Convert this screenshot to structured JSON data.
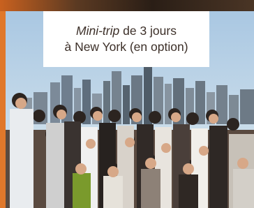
{
  "caption": {
    "line1_italic": "Mini-trip",
    "line1_rest": " de 3 jours",
    "line2": "à New York (en option)"
  },
  "photo": {
    "subject": "group-of-students-with-new-york-skyline",
    "colors": {
      "sky": "#b9d2e6",
      "accent_bar": "#e0782b"
    }
  }
}
